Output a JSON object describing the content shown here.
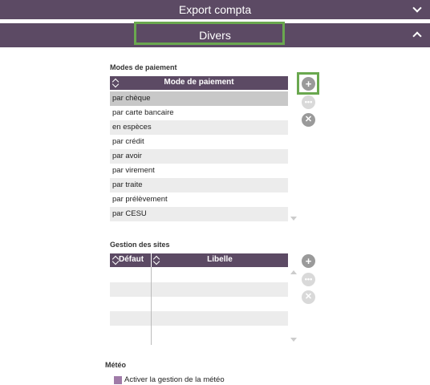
{
  "sections": {
    "export": {
      "title": "Export compta"
    },
    "divers": {
      "title": "Divers"
    }
  },
  "payment": {
    "section_label": "Modes de paiement",
    "column_header": "Mode de paiement",
    "rows": [
      "par chèque",
      "par carte bancaire",
      "en espèces",
      "par crédit",
      "par avoir",
      "par virement",
      "par traite",
      "par prélèvement",
      "par CESU"
    ],
    "selected_index": 0
  },
  "sites": {
    "section_label": "Gestion des sites",
    "columns": [
      "Défaut",
      "Libelle"
    ]
  },
  "meteo": {
    "section_label": "Météo",
    "checkbox_label": "Activer la gestion de la météo",
    "checked": false
  },
  "icons": {
    "add": "plus-circle-icon",
    "edit": "ellipsis-circle-icon",
    "delete": "x-circle-icon",
    "sort": "sort-arrows-icon"
  },
  "colors": {
    "header_bg": "#5c4a64",
    "highlight": "#6aa84f",
    "checkbox": "#a07ba8"
  }
}
